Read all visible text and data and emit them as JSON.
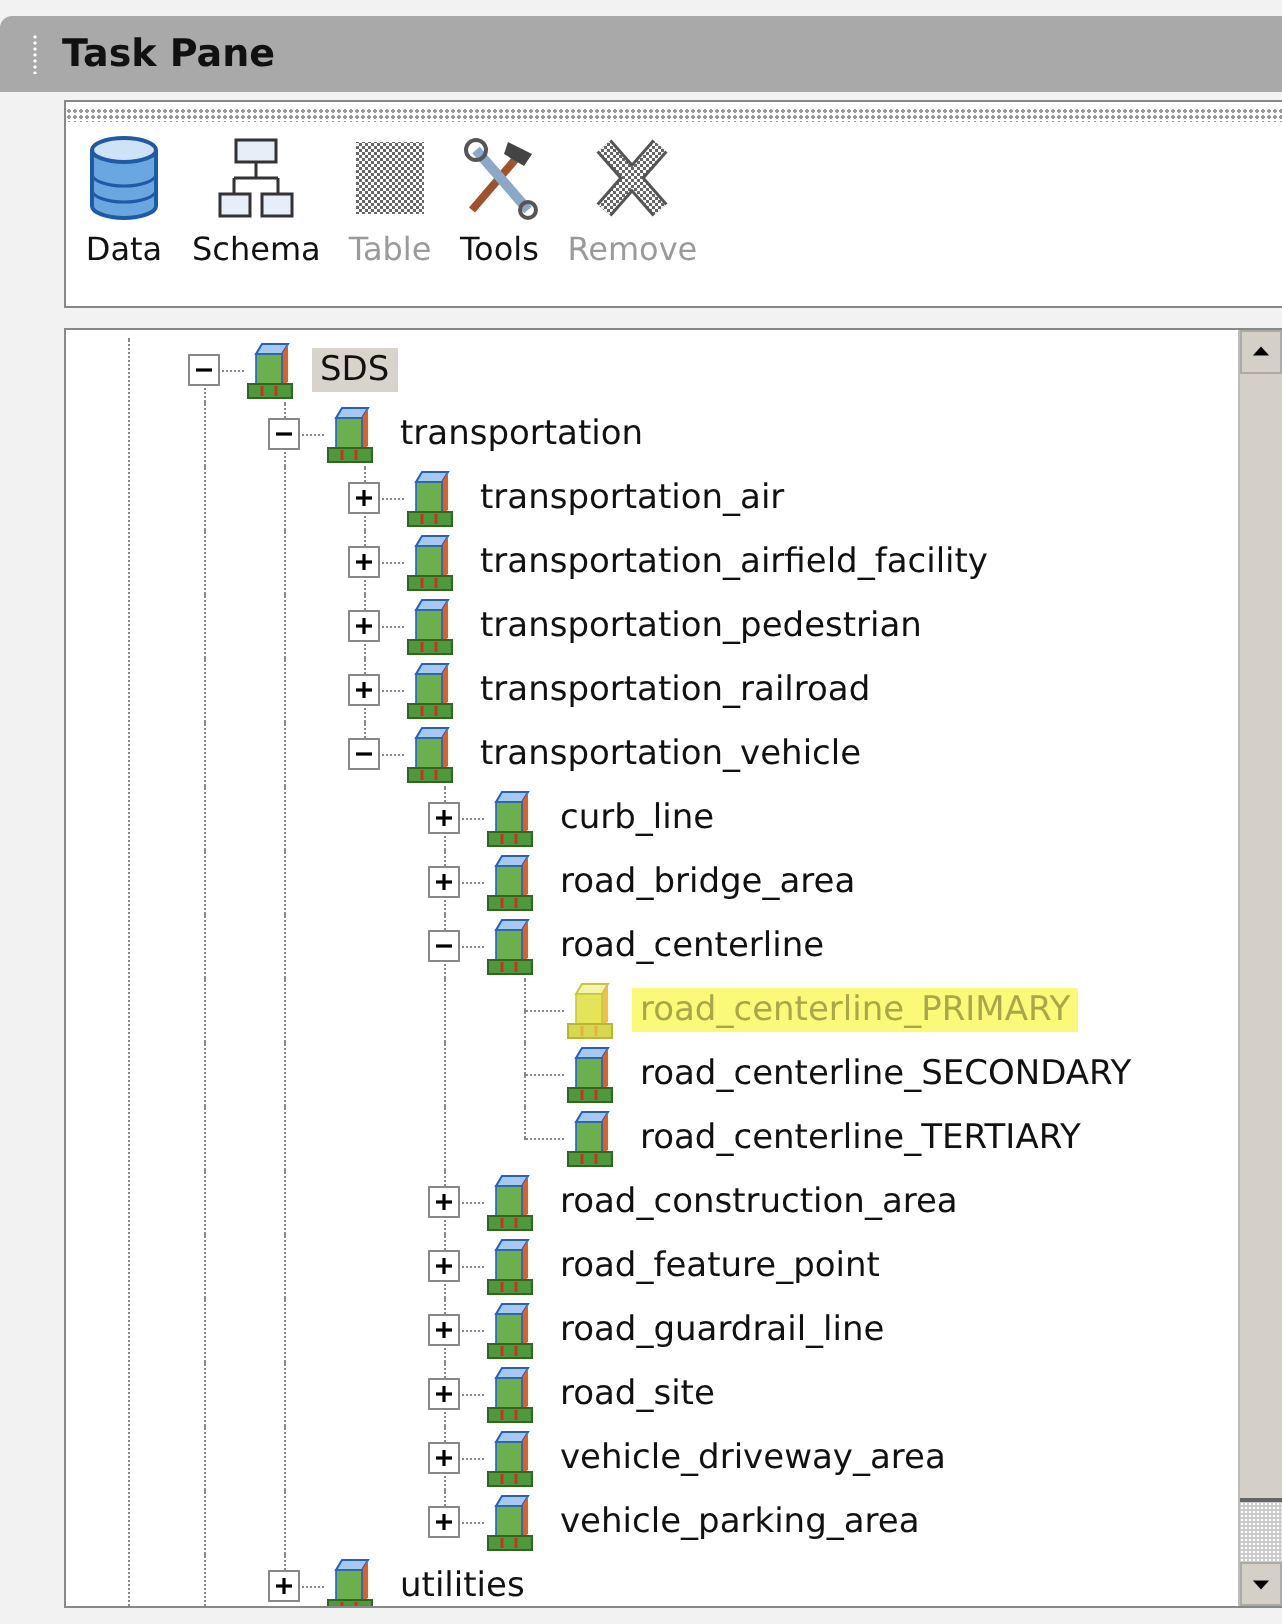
{
  "title_bar": {
    "title": "Task Pane"
  },
  "toolbar": [
    {
      "label": "Data",
      "kind": "database",
      "disabled": false
    },
    {
      "label": "Schema",
      "kind": "schema",
      "disabled": false
    },
    {
      "label": "Table",
      "kind": "table",
      "disabled": true
    },
    {
      "label": "Tools",
      "kind": "tools",
      "disabled": false
    },
    {
      "label": "Remove",
      "kind": "remove",
      "disabled": true
    }
  ],
  "tree": [
    {
      "label": "SDS",
      "expanded": true,
      "selected": true,
      "highlighted": false,
      "children": [
        {
          "label": "transportation",
          "expanded": true,
          "selected": false,
          "highlighted": false,
          "children": [
            {
              "label": "transportation_air",
              "expanded": false,
              "selected": false,
              "highlighted": false
            },
            {
              "label": "transportation_airfield_facility",
              "expanded": false,
              "selected": false,
              "highlighted": false
            },
            {
              "label": "transportation_pedestrian",
              "expanded": false,
              "selected": false,
              "highlighted": false
            },
            {
              "label": "transportation_railroad",
              "expanded": false,
              "selected": false,
              "highlighted": false
            },
            {
              "label": "transportation_vehicle",
              "expanded": true,
              "selected": false,
              "highlighted": false,
              "children": [
                {
                  "label": "curb_line",
                  "expanded": false,
                  "selected": false,
                  "highlighted": false
                },
                {
                  "label": "road_bridge_area",
                  "expanded": false,
                  "selected": false,
                  "highlighted": false
                },
                {
                  "label": "road_centerline",
                  "expanded": true,
                  "selected": false,
                  "highlighted": false,
                  "children": [
                    {
                      "label": "road_centerline_PRIMARY",
                      "selected": false,
                      "highlighted": true
                    },
                    {
                      "label": "road_centerline_SECONDARY",
                      "selected": false,
                      "highlighted": false
                    },
                    {
                      "label": "road_centerline_TERTIARY",
                      "selected": false,
                      "highlighted": false
                    }
                  ]
                },
                {
                  "label": "road_construction_area",
                  "expanded": false,
                  "selected": false,
                  "highlighted": false
                },
                {
                  "label": "road_feature_point",
                  "expanded": false,
                  "selected": false,
                  "highlighted": false
                },
                {
                  "label": "road_guardrail_line",
                  "expanded": false,
                  "selected": false,
                  "highlighted": false
                },
                {
                  "label": "road_site",
                  "expanded": false,
                  "selected": false,
                  "highlighted": false
                },
                {
                  "label": "vehicle_driveway_area",
                  "expanded": false,
                  "selected": false,
                  "highlighted": false
                },
                {
                  "label": "vehicle_parking_area",
                  "expanded": false,
                  "selected": false,
                  "highlighted": false
                }
              ]
            }
          ]
        },
        {
          "label": "utilities",
          "expanded": false,
          "selected": false,
          "highlighted": false
        }
      ]
    }
  ]
}
